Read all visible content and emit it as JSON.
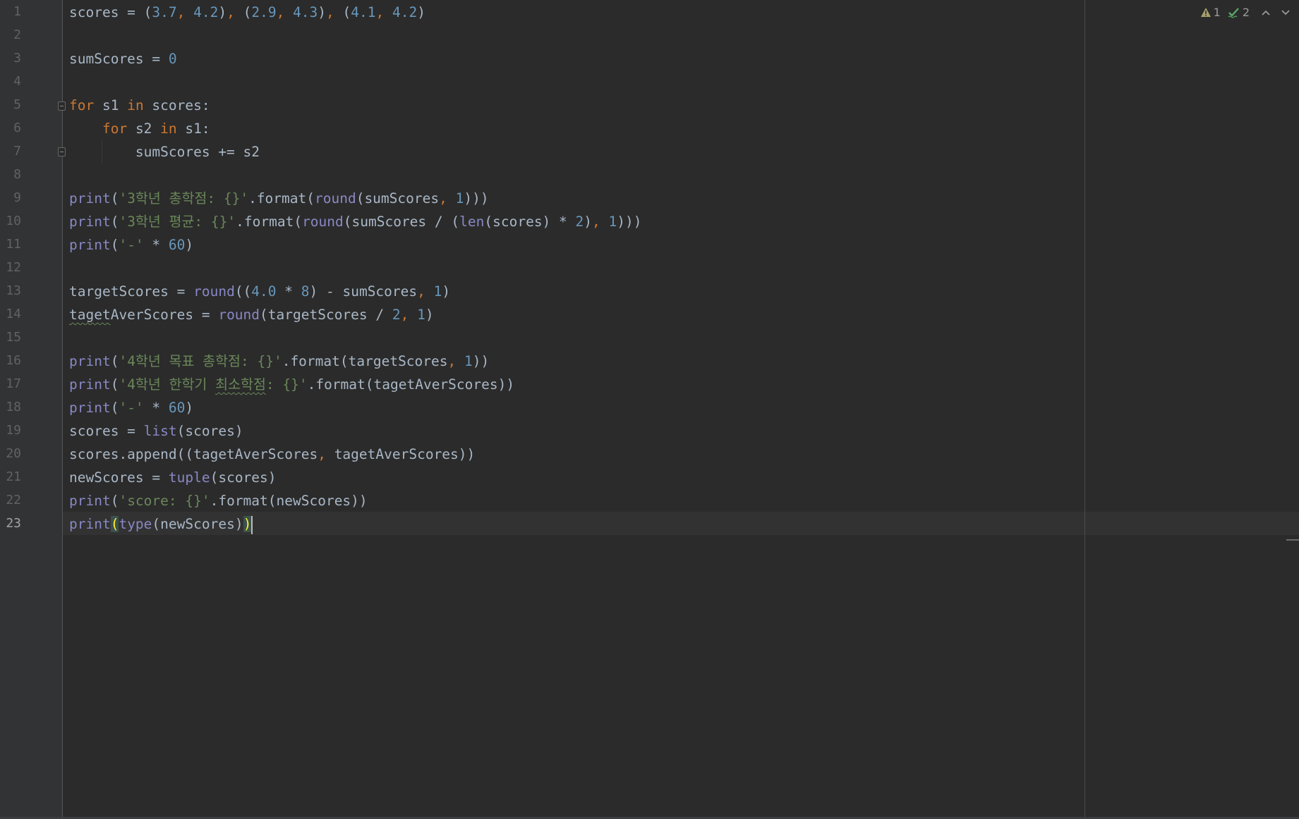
{
  "line_numbers": [
    "1",
    "2",
    "3",
    "4",
    "5",
    "6",
    "7",
    "8",
    "9",
    "10",
    "11",
    "12",
    "13",
    "14",
    "15",
    "16",
    "17",
    "18",
    "19",
    "20",
    "21",
    "22",
    "23"
  ],
  "current_line": "23",
  "inspections": {
    "warning_count": "1",
    "typo_count": "2",
    "warning_icon": "warning-triangle-icon",
    "typo_icon": "typo-check-icon",
    "prev_icon": "chevron-up-icon",
    "next_icon": "chevron-down-icon"
  },
  "colors": {
    "background": "#2b2b2b",
    "keyword": "#cc7832",
    "number": "#6897bb",
    "string": "#6a8759",
    "builtin": "#8888c6",
    "default": "#a9b7c6"
  },
  "code": {
    "l1": [
      {
        "t": "scores = (",
        "c": ""
      },
      {
        "t": "3.7",
        "c": "num"
      },
      {
        "t": ", ",
        "c": "op"
      },
      {
        "t": "4.2",
        "c": "num"
      },
      {
        "t": "), ",
        "c": "op2"
      },
      {
        "t": "(",
        "c": ""
      },
      {
        "t": "2.9",
        "c": "num"
      },
      {
        "t": ", ",
        "c": "op"
      },
      {
        "t": "4.3",
        "c": "num"
      },
      {
        "t": "), ",
        "c": "op2"
      },
      {
        "t": "(",
        "c": ""
      },
      {
        "t": "4.1",
        "c": "num"
      },
      {
        "t": ", ",
        "c": "op"
      },
      {
        "t": "4.2",
        "c": "num"
      },
      {
        "t": ")",
        "c": ""
      }
    ],
    "l3": "sumScores = 0",
    "l5": "for s1 in scores:",
    "l6": "    for s2 in s1:",
    "l7": "        sumScores += s2",
    "l9": "print('3학년 총학점: {}'.format(round(sumScores, 1)))",
    "l10": "print('3학년 평균: {}'.format(round(sumScores / (len(scores) * 2), 1)))",
    "l11": "print('-' * 60)",
    "l13": "targetScores = round((4.0 * 8) - sumScores, 1)",
    "l14": "tagetAverScores = round(targetScores / 2, 1)",
    "l16": "print('4학년 목표 총학점: {}'.format(targetScores, 1))",
    "l17": "print('4학년 한학기 최소학점: {}'.format(tagetAverScores))",
    "l18": "print('-' * 60)",
    "l19": "scores = list(scores)",
    "l20": "scores.append((tagetAverScores, tagetAverScores))",
    "l21": "newScores = tuple(scores)",
    "l22": "print('score: {}'.format(newScores))",
    "l23": "print(type(newScores))"
  }
}
